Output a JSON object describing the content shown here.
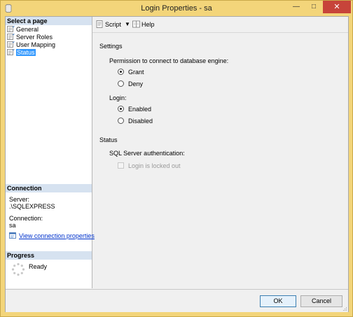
{
  "window": {
    "title": "Login Properties - sa"
  },
  "sidebar": {
    "select_page_header": "Select a page",
    "pages": [
      {
        "label": "General",
        "selected": false
      },
      {
        "label": "Server Roles",
        "selected": false
      },
      {
        "label": "User Mapping",
        "selected": false
      },
      {
        "label": "Status",
        "selected": true
      }
    ],
    "connection": {
      "header": "Connection",
      "server_label": "Server:",
      "server_value": ".\\SQLEXPRESS",
      "connection_label": "Connection:",
      "connection_value": "sa",
      "view_link": "View connection properties"
    },
    "progress": {
      "header": "Progress",
      "status": "Ready"
    }
  },
  "toolbar": {
    "script_label": "Script",
    "help_label": "Help"
  },
  "settings": {
    "header": "Settings",
    "permission_label": "Permission to connect to database engine:",
    "permission_options": [
      {
        "label": "Grant",
        "checked": true
      },
      {
        "label": "Deny",
        "checked": false
      }
    ],
    "login_label": "Login:",
    "login_options": [
      {
        "label": "Enabled",
        "checked": true
      },
      {
        "label": "Disabled",
        "checked": false
      }
    ]
  },
  "status": {
    "header": "Status",
    "auth_label": "SQL Server authentication:",
    "locked_out_label": "Login is locked out",
    "locked_out_checked": false
  },
  "buttons": {
    "ok": "OK",
    "cancel": "Cancel"
  },
  "colors": {
    "title_bar": "#f3d57a",
    "close_button": "#c7443a",
    "selection": "#3399ff",
    "link": "#0033cc"
  }
}
